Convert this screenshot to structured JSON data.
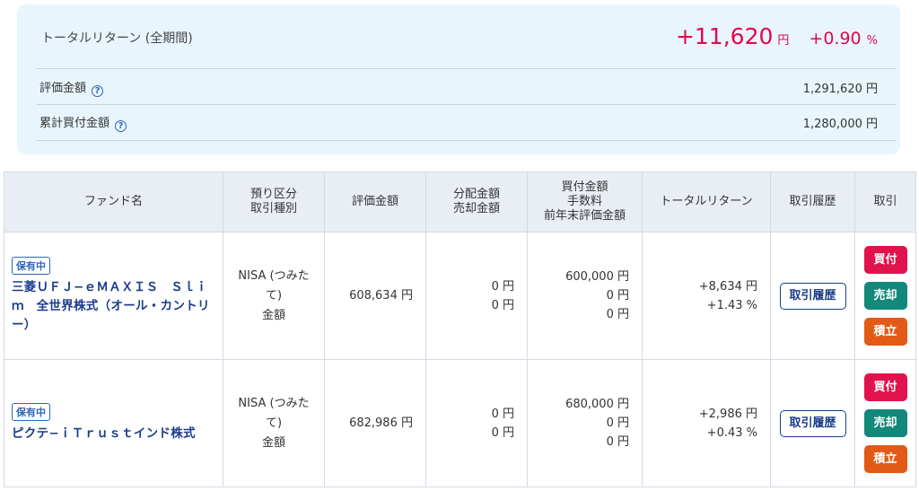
{
  "summary": {
    "total_return_label": "トータルリターン (全期間)",
    "total_return_value": "+11,620",
    "total_return_unit": "円",
    "total_return_pct": "+0.90",
    "total_return_pct_unit": "%",
    "valuation_label": "評価金額",
    "valuation_value": "1,291,620 円",
    "cumulative_buy_label": "累計買付金額",
    "cumulative_buy_value": "1,280,000 円",
    "help_glyph": "?"
  },
  "colors": {
    "positive": "#e1084f",
    "buy": "#e0134d",
    "sell": "#11887a",
    "accumulate": "#e25a16",
    "accent": "#1a3c8c"
  },
  "table": {
    "headers": {
      "fund_name": "ファンド名",
      "custody": [
        "預り区分",
        "取引種別"
      ],
      "valuation": "評価金額",
      "distribution": [
        "分配金額",
        "売却金額"
      ],
      "buy": [
        "買付金額",
        "手数料",
        "前年末評価金額"
      ],
      "total_return": "トータルリターン",
      "history": "取引履歴",
      "trade": "取引"
    },
    "rows": [
      {
        "badge": "保有中",
        "fund_name": "三菱ＵＦＪ−ｅＭＡＸＩＳ　Ｓｌｉｍ　全世界株式（オール・カントリー）",
        "custody_1": "NISA (つみた",
        "custody_2": "て)",
        "custody_3": "金額",
        "valuation": "608,634 円",
        "distribution": "0 円",
        "sale": "0 円",
        "buy_amount": "600,000 円",
        "fee": "0 円",
        "prev_year_val": "0 円",
        "return_amount": "+8,634 円",
        "return_pct": "+1.43 %",
        "history_btn": "取引履歴",
        "buy_btn": "買付",
        "sell_btn": "売却",
        "acc_btn": "積立"
      },
      {
        "badge": "保有中",
        "fund_name": "ピクテ−ｉＴｒｕｓｔインド株式",
        "custody_1": "NISA (つみた",
        "custody_2": "て)",
        "custody_3": "金額",
        "valuation": "682,986 円",
        "distribution": "0 円",
        "sale": "0 円",
        "buy_amount": "680,000 円",
        "fee": "0 円",
        "prev_year_val": "0 円",
        "return_amount": "+2,986 円",
        "return_pct": "+0.43 %",
        "history_btn": "取引履歴",
        "buy_btn": "買付",
        "sell_btn": "売却",
        "acc_btn": "積立"
      }
    ]
  }
}
